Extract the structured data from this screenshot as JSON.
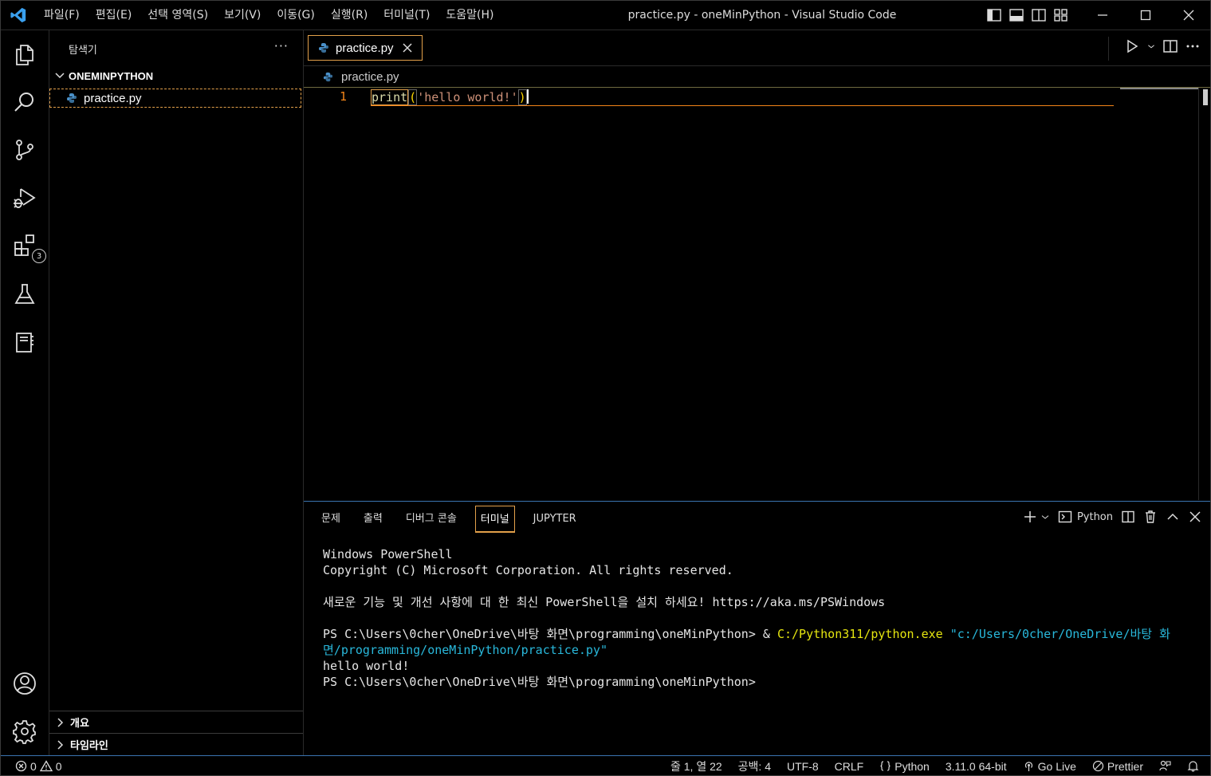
{
  "window": {
    "title": "practice.py - oneMinPython - Visual Studio Code",
    "menu": [
      "파일(F)",
      "편집(E)",
      "선택 영역(S)",
      "보기(V)",
      "이동(G)",
      "실행(R)",
      "터미널(T)",
      "도움말(H)"
    ]
  },
  "activity_bar": {
    "icons": [
      "explorer-icon",
      "search-icon",
      "source-control-icon",
      "run-debug-icon",
      "extensions-icon",
      "testing-icon",
      "notebook-icon",
      "account-icon",
      "settings-gear-icon"
    ],
    "extensions_badge": "3"
  },
  "sidebar": {
    "title": "탐색기",
    "more": "···",
    "folder": "ONEMINPYTHON",
    "files": [
      "practice.py"
    ],
    "sections": [
      "개요",
      "타임라인"
    ]
  },
  "editor": {
    "tab_label": "practice.py",
    "breadcrumb": "practice.py",
    "line_number": "1",
    "code": {
      "fn": "print",
      "open": "(",
      "str": "'hello world!'",
      "close": ")"
    }
  },
  "panel": {
    "tabs": [
      "문제",
      "출력",
      "디버그 콘솔",
      "터미널",
      "JUPYTER"
    ],
    "active_tab": "터미널",
    "shell_label": "Python",
    "terminal": {
      "line1": "Windows PowerShell",
      "line2": "Copyright (C) Microsoft Corporation. All rights reserved.",
      "line3": "새로운 기능 및 개선 사항에 대 한 최신 PowerShell을 설치 하세요! https://aka.ms/PSWindows",
      "prompt": "PS C:\\Users\\0cher\\OneDrive\\바탕 화면\\programming\\oneMinPython> ",
      "cmd_amp": "& ",
      "cmd_exe": "C:/Python311/python.exe",
      "cmd_arg1": " \"c:/Users/0cher/OneDrive/바탕 화",
      "cmd_arg2": "면/programming/oneMinPython/practice.py\"",
      "output": "hello world!",
      "prompt2": "PS C:\\Users\\0cher\\OneDrive\\바탕 화면\\programming\\oneMinPython>"
    }
  },
  "status_bar": {
    "errors": "0",
    "warnings": "0",
    "position": "줄 1, 열 22",
    "indent": "공백: 4",
    "encoding": "UTF-8",
    "eol": "CRLF",
    "language": "Python",
    "interpreter": "3.11.0 64-bit",
    "go_live": "Go Live",
    "prettier": "Prettier"
  },
  "colors": {
    "focus_border": "#e3a04a",
    "accent_blue": "#3a74b0",
    "line_number": "#f38518",
    "string": "#ce9178",
    "function": "#dcdcaa"
  }
}
